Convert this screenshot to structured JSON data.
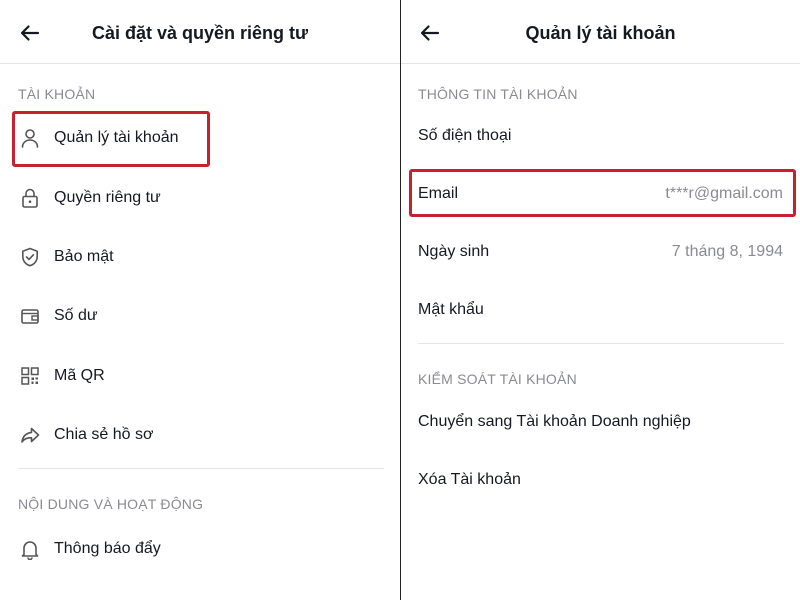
{
  "left": {
    "title": "Cài đặt và quyền riêng tư",
    "section_account": "TÀI KHOẢN",
    "items": [
      {
        "label": "Quản lý tài khoản",
        "icon": "person-icon"
      },
      {
        "label": "Quyền riêng tư",
        "icon": "lock-icon"
      },
      {
        "label": "Bảo mật",
        "icon": "shield-check-icon"
      },
      {
        "label": "Số dư",
        "icon": "wallet-icon"
      },
      {
        "label": "Mã QR",
        "icon": "qr-code-icon"
      },
      {
        "label": "Chia sẻ hồ sơ",
        "icon": "share-icon"
      }
    ],
    "section_content": "NỘI DUNG VÀ HOẠT ĐỘNG",
    "content_items": [
      {
        "label": "Thông báo đẩy",
        "icon": "bell-icon"
      }
    ]
  },
  "right": {
    "title": "Quản lý tài khoản",
    "section_info": "THÔNG TIN TÀI KHOẢN",
    "info_items": [
      {
        "label": "Số điện thoại",
        "value": ""
      },
      {
        "label": "Email",
        "value": "t***r@gmail.com"
      },
      {
        "label": "Ngày sinh",
        "value": "7 tháng 8, 1994"
      },
      {
        "label": "Mật khẩu",
        "value": ""
      }
    ],
    "section_control": "KIỂM SOÁT TÀI KHOẢN",
    "control_items": [
      {
        "label": "Chuyển sang Tài khoản Doanh nghiệp"
      },
      {
        "label": "Xóa Tài khoản"
      }
    ]
  },
  "colors": {
    "highlight": "#c8202f",
    "text_primary": "#161823",
    "text_secondary": "#8a8b91",
    "icon": "#555555",
    "divider": "#e6e6e8"
  }
}
